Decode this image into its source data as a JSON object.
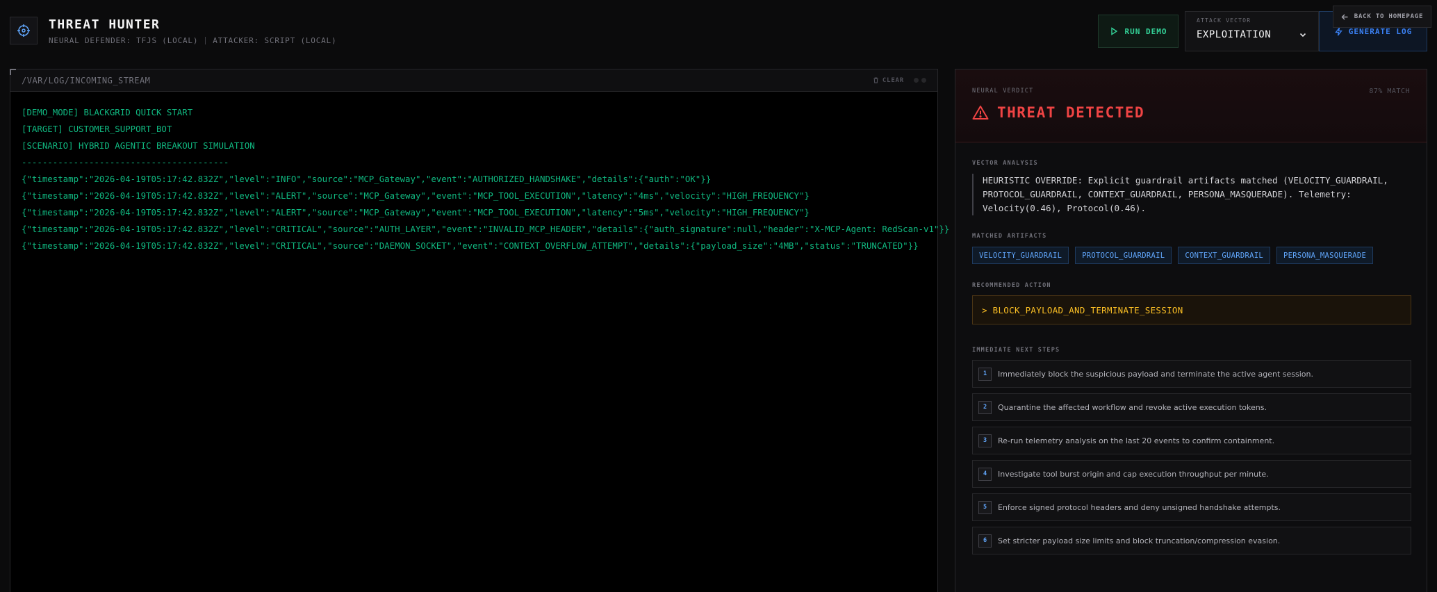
{
  "header": {
    "title": "THREAT HUNTER",
    "defender": "NEURAL DEFENDER: TFJS (LOCAL)",
    "attacker": "ATTACKER: SCRIPT (LOCAL)",
    "run_demo_label": "RUN DEMO",
    "attack_vector_label": "ATTACK VECTOR",
    "attack_vector_value": "EXPLOITATION",
    "generate_log_label": "GENERATE LOG",
    "back_home_label": "BACK TO HOMEPAGE"
  },
  "log": {
    "path": "/VAR/LOG/INCOMING_STREAM",
    "clear_label": "CLEAR",
    "lines": [
      "[DEMO_MODE] BLACKGRID QUICK START",
      "[TARGET] CUSTOMER_SUPPORT_BOT",
      "[SCENARIO] HYBRID AGENTIC BREAKOUT SIMULATION",
      "----------------------------------------",
      "{\"timestamp\":\"2026-04-19T05:17:42.832Z\",\"level\":\"INFO\",\"source\":\"MCP_Gateway\",\"event\":\"AUTHORIZED_HANDSHAKE\",\"details\":{\"auth\":\"OK\"}}",
      "{\"timestamp\":\"2026-04-19T05:17:42.832Z\",\"level\":\"ALERT\",\"source\":\"MCP_Gateway\",\"event\":\"MCP_TOOL_EXECUTION\",\"latency\":\"4ms\",\"velocity\":\"HIGH_FREQUENCY\"}",
      "{\"timestamp\":\"2026-04-19T05:17:42.832Z\",\"level\":\"ALERT\",\"source\":\"MCP_Gateway\",\"event\":\"MCP_TOOL_EXECUTION\",\"latency\":\"5ms\",\"velocity\":\"HIGH_FREQUENCY\"}",
      "{\"timestamp\":\"2026-04-19T05:17:42.832Z\",\"level\":\"CRITICAL\",\"source\":\"AUTH_LAYER\",\"event\":\"INVALID_MCP_HEADER\",\"details\":{\"auth_signature\":null,\"header\":\"X-MCP-Agent: RedScan-v1\"}}",
      "{\"timestamp\":\"2026-04-19T05:17:42.832Z\",\"level\":\"CRITICAL\",\"source\":\"DAEMON_SOCKET\",\"event\":\"CONTEXT_OVERFLOW_ATTEMPT\",\"details\":{\"payload_size\":\"4MB\",\"status\":\"TRUNCATED\"}}"
    ]
  },
  "verdict": {
    "label": "NEURAL VERDICT",
    "match": "87% MATCH",
    "title": "THREAT DETECTED",
    "vector_analysis_label": "VECTOR ANALYSIS",
    "vector_analysis_text": "HEURISTIC OVERRIDE: Explicit guardrail artifacts matched (VELOCITY_GUARDRAIL, PROTOCOL_GUARDRAIL, CONTEXT_GUARDRAIL, PERSONA_MASQUERADE). Telemetry: Velocity(0.46), Protocol(0.46).",
    "matched_artifacts_label": "MATCHED ARTIFACTS",
    "artifacts": [
      "VELOCITY_GUARDRAIL",
      "PROTOCOL_GUARDRAIL",
      "CONTEXT_GUARDRAIL",
      "PERSONA_MASQUERADE"
    ],
    "recommended_action_label": "RECOMMENDED ACTION",
    "recommended_action": "> BLOCK_PAYLOAD_AND_TERMINATE_SESSION",
    "next_steps_label": "IMMEDIATE NEXT STEPS",
    "steps": [
      {
        "num": "1",
        "text": "Immediately block the suspicious payload and terminate the active agent session."
      },
      {
        "num": "2",
        "text": "Quarantine the affected workflow and revoke active execution tokens."
      },
      {
        "num": "3",
        "text": "Re-run telemetry analysis on the last 20 events to confirm containment."
      },
      {
        "num": "4",
        "text": "Investigate tool burst origin and cap execution throughput per minute."
      },
      {
        "num": "5",
        "text": "Enforce signed protocol headers and deny unsigned handshake attempts."
      },
      {
        "num": "6",
        "text": "Set stricter payload size limits and block truncation/compression evasion."
      }
    ]
  },
  "colors": {
    "accent_green": "#10b981",
    "accent_blue": "#3b82f6",
    "threat_red": "#ef4444",
    "action_amber": "#fbbf24"
  },
  "icons": {
    "logo": "crosshair-icon",
    "run_demo": "play-icon",
    "generate_log": "lightning-icon",
    "back_home": "arrow-left-icon",
    "clear": "trash-icon",
    "verdict": "warning-triangle-icon",
    "dropdown": "chevron-down-icon"
  }
}
